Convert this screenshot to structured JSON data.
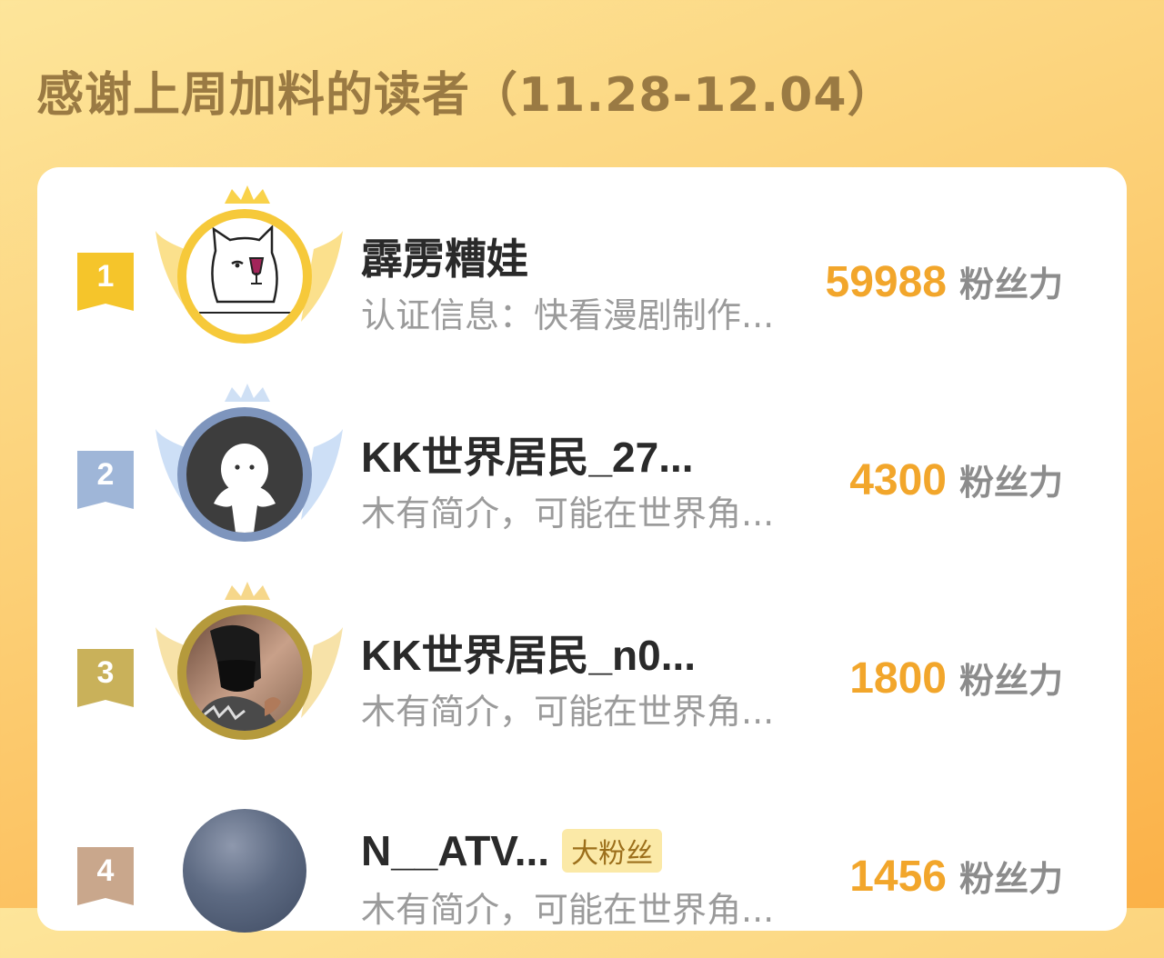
{
  "page": {
    "title": "感谢上周加料的读者（11.28-12.04）"
  },
  "colors": {
    "gold": "#f5c52b",
    "silver": "#9fb6d8",
    "bronze": "#c9b15a",
    "fourth": "#c9a78c",
    "score": "#f2a62b"
  },
  "readers": [
    {
      "rank": "1",
      "name": "霹雳糟娃",
      "bio": "认证信息：快看漫剧制作...",
      "score": "59988",
      "unit": "粉丝力",
      "avatar": "cat-drinking-wine-icon",
      "tier": "gold"
    },
    {
      "rank": "2",
      "name": "KK世界居民_27...",
      "bio": "木有简介，可能在世界角...",
      "score": "4300",
      "unit": "粉丝力",
      "avatar": "default-ghost-avatar-icon",
      "tier": "silver"
    },
    {
      "rank": "3",
      "name": "KK世界居民_n0...",
      "bio": "木有简介，可能在世界角...",
      "score": "1800",
      "unit": "粉丝力",
      "avatar": "person-photo-avatar",
      "tier": "bronze"
    },
    {
      "rank": "4",
      "name": "N__ATV...",
      "tag": "大粉丝",
      "bio": "木有简介，可能在世界角...",
      "score": "1456",
      "unit": "粉丝力",
      "avatar": "clouds-photo-avatar",
      "tier": "none"
    }
  ]
}
